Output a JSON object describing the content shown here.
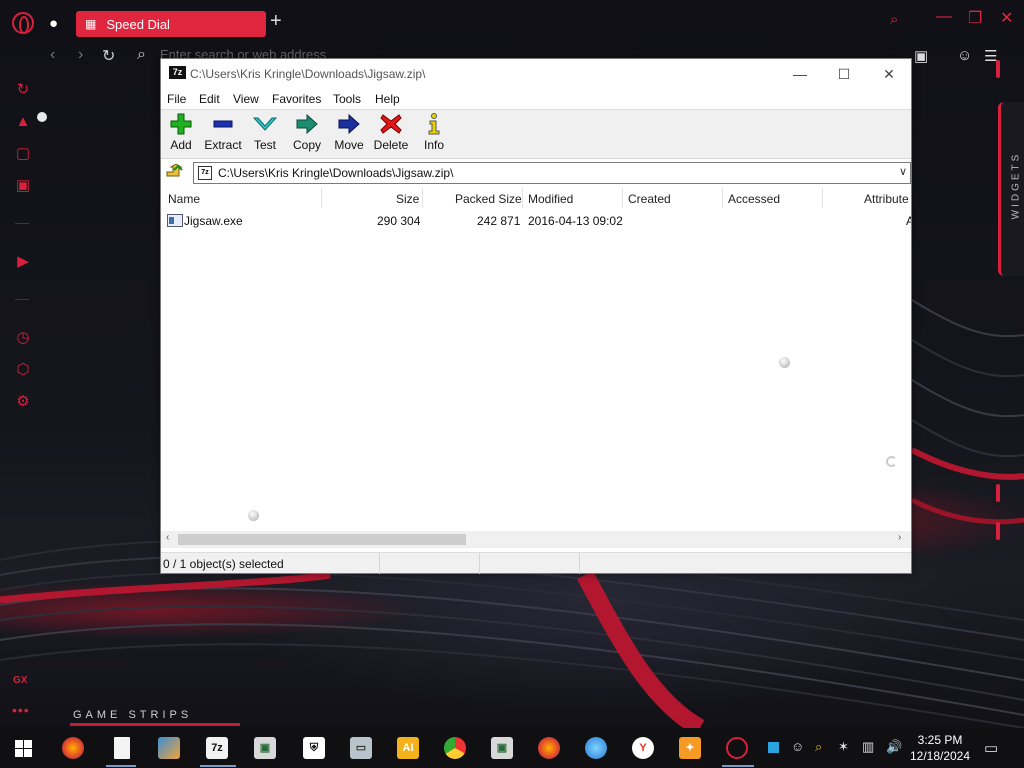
{
  "browser": {
    "tab_title": "Speed Dial",
    "address_placeholder": "Enter search or web address",
    "widgets_label": "WIDGETS",
    "gx_label": "GX",
    "game_strips_label": "GAME STRIPS",
    "accent_color": "#e0263f"
  },
  "window": {
    "title": "C:\\Users\\Kris Kringle\\Downloads\\Jigsaw.zip\\",
    "app_icon_text": "7z",
    "menu": [
      "File",
      "Edit",
      "View",
      "Favorites",
      "Tools",
      "Help"
    ],
    "toolbar": [
      {
        "label": "Add",
        "icon": "plus-icon"
      },
      {
        "label": "Extract",
        "icon": "minus-icon"
      },
      {
        "label": "Test",
        "icon": "check-icon"
      },
      {
        "label": "Copy",
        "icon": "copy-arrow-icon"
      },
      {
        "label": "Move",
        "icon": "move-arrow-icon"
      },
      {
        "label": "Delete",
        "icon": "x-icon"
      },
      {
        "label": "Info",
        "icon": "info-icon"
      }
    ],
    "address": "C:\\Users\\Kris Kringle\\Downloads\\Jigsaw.zip\\",
    "columns": [
      "Name",
      "Size",
      "Packed Size",
      "Modified",
      "Created",
      "Accessed",
      "Attribute"
    ],
    "files": [
      {
        "name": "Jigsaw.exe",
        "size": "290 304",
        "packed": "242 871",
        "modified": "2016-04-13 09:02",
        "created": "",
        "accessed": "",
        "attr": "A"
      }
    ],
    "status": "0 / 1 object(s) selected"
  },
  "taskbar": {
    "time": "3:25 PM",
    "date": "12/18/2024",
    "apps": [
      "firefox",
      "file",
      "paint",
      "7z",
      "app",
      "shield",
      "monitor",
      "ai",
      "chrome",
      "app2",
      "firefox2",
      "globe",
      "yandex",
      "ws",
      "opera"
    ]
  }
}
